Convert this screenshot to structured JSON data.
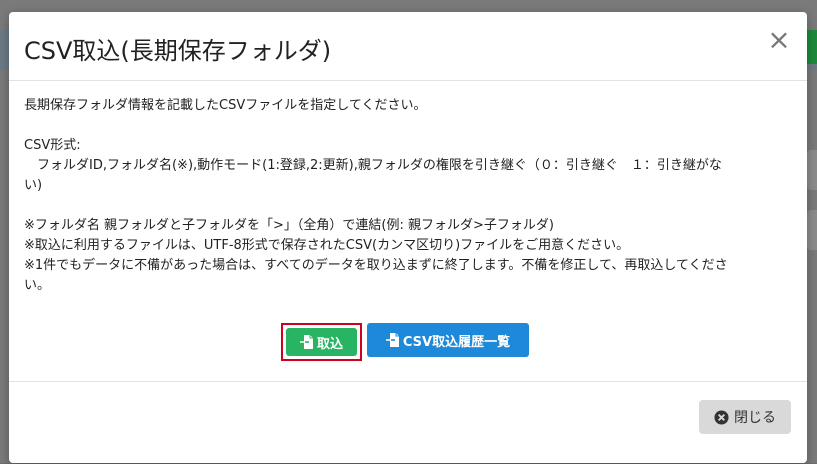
{
  "modal": {
    "title": "CSV取込(長期保存フォルダ)",
    "close_symbol": "×",
    "body": {
      "intro": "長期保存フォルダ情報を記載したCSVファイルを指定してください。",
      "format_heading": "CSV形式:",
      "format_line_1": "　フォルダID,フォルダ名(※),動作モード(1:登録,2:更新),親フォルダの権限を引き継ぐ（０：引き継ぐ　１：引き継がな",
      "format_line_2": "い)",
      "note_1": "※フォルダ名 親フォルダと子フォルダを「>」（全角）で連結(例: 親フォルダ>子フォルダ)",
      "note_2": "※取込に利用するファイルは、UTF-8形式で保存されたCSV(カンマ区切り)ファイルをご用意ください。",
      "note_3a": "※1件でもデータに不備があった場合は、すべてのデータを取り込まずに終了します。不備を修正して、再取込してくださ",
      "note_3b": "い。"
    },
    "buttons": {
      "import_label": "取込",
      "import_icon": "file-import-icon",
      "history_label": "CSV取込履歴一覧",
      "history_icon": "file-import-icon"
    },
    "footer": {
      "close_label": "閉じる",
      "close_icon": "times-circle-icon"
    }
  },
  "colors": {
    "import_button": "#28b463",
    "history_button": "#1e88d9",
    "highlight_border": "#d0021b",
    "close_button": "#d9d9d9"
  }
}
